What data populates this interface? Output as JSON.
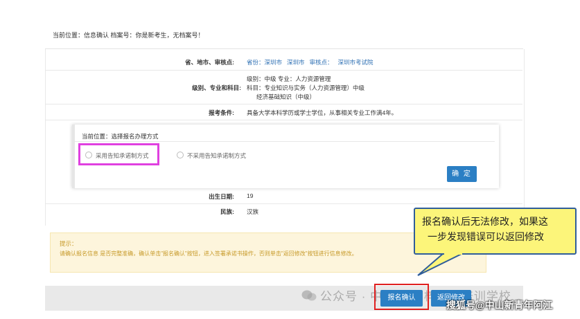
{
  "breadcrumb": "当前位置：信息确认   档案号：你是新考生，无档案号！",
  "form": {
    "province_label": "省、地市、审核点:",
    "province_items": [
      "省份：深圳市",
      "深圳市",
      "审核点：",
      "深圳市考试院"
    ],
    "level_label": "级别、专业和科目:",
    "level_lines": [
      "级别：中级   专业：人力资源管理",
      "科目：专业知识与实务（人力资源管理）中级",
      "经济基础知识（中级）"
    ],
    "condition_label": "报考条件:",
    "condition_value": "具备大学本科学历或学士学位，从事相关专业工作满4年。",
    "birth_label": "出生日期:",
    "birth_value": "19",
    "ethnic_label": "民族:",
    "ethnic_value": "汉族"
  },
  "dialog": {
    "title": "当前位置：选择报名办理方式",
    "option1": "采用告知承诺制方式",
    "option2": "不采用告知承诺制方式",
    "confirm": "确 定"
  },
  "tip": {
    "title": "提示：",
    "text": "请确认报名信息 是否完整准确，确认单击\"报名确认\"按钮，进入签署承诺书操作，否则单击\"返回修改\"按钮进行信息修改。"
  },
  "buttons": {
    "sign": "报名确认",
    "back": "返回修改"
  },
  "callout": {
    "line1": "报名确认后无法修改，如果这",
    "line2": "一步发现错误可以返回修改"
  },
  "watermark": {
    "official": "公众号 · 中山市 青梓职业培训学校",
    "sohu": "搜狐号@中山新青年阿江"
  },
  "colors": {
    "primary": "#2b7fc4",
    "link": "#2d6fb3",
    "highlight_pink": "#e040e0",
    "highlight_red": "#e02020",
    "callout_fill": "#fcf57a",
    "tip_fill": "#fdf5dc"
  }
}
